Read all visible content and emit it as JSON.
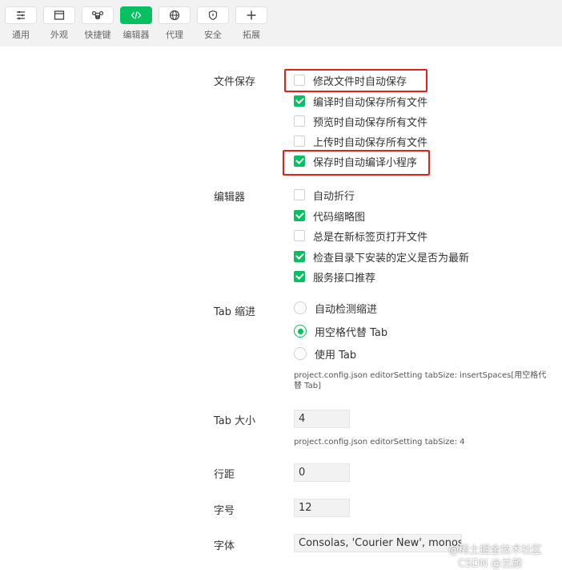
{
  "toolbar": {
    "items": [
      {
        "label": "通用",
        "icon": "sliders-icon",
        "active": false
      },
      {
        "label": "外观",
        "icon": "window-icon",
        "active": false
      },
      {
        "label": "快捷键",
        "icon": "command-key-icon",
        "active": false
      },
      {
        "label": "编辑器",
        "icon": "code-icon",
        "active": true
      },
      {
        "label": "代理",
        "icon": "globe-icon",
        "active": false
      },
      {
        "label": "安全",
        "icon": "shield-icon",
        "active": false
      },
      {
        "label": "拓展",
        "icon": "plus-icon",
        "active": false
      }
    ],
    "accent": "#07c160"
  },
  "file_save": {
    "label": "文件保存",
    "options": [
      {
        "label": "修改文件时自动保存",
        "checked": false
      },
      {
        "label": "编译时自动保存所有文件",
        "checked": true
      },
      {
        "label": "预览时自动保存所有文件",
        "checked": false
      },
      {
        "label": "上传时自动保存所有文件",
        "checked": false
      },
      {
        "label": "保存时自动编译小程序",
        "checked": true
      }
    ]
  },
  "editor": {
    "label": "编辑器",
    "options": [
      {
        "label": "自动折行",
        "checked": false
      },
      {
        "label": "代码缩略图",
        "checked": true
      },
      {
        "label": "总是在新标签页打开文件",
        "checked": false
      },
      {
        "label": "检查目录下安装的定义是否为最新",
        "checked": true
      },
      {
        "label": "服务接口推荐",
        "checked": true
      }
    ]
  },
  "tab_indent": {
    "label": "Tab 缩进",
    "options": [
      {
        "label": "自动检测缩进",
        "selected": false
      },
      {
        "label": "用空格代替 Tab",
        "selected": true
      },
      {
        "label": "使用 Tab",
        "selected": false
      }
    ],
    "hint": "project.config.json editorSetting tabSize: insertSpaces[用空格代替 Tab]"
  },
  "tab_size": {
    "label": "Tab 大小",
    "value": "4",
    "hint": "project.config.json editorSetting tabSize: 4"
  },
  "line_height": {
    "label": "行距",
    "value": "0"
  },
  "font_size": {
    "label": "字号",
    "value": "12"
  },
  "font_family": {
    "label": "字体",
    "value": "Consolas, 'Courier New', monospace"
  },
  "watermark": {
    "line1": "@稀土掘金技术社区",
    "line2": "CSDN @兰颜"
  },
  "colors": {
    "highlight": "#e0201a",
    "checked": "#07c160"
  }
}
